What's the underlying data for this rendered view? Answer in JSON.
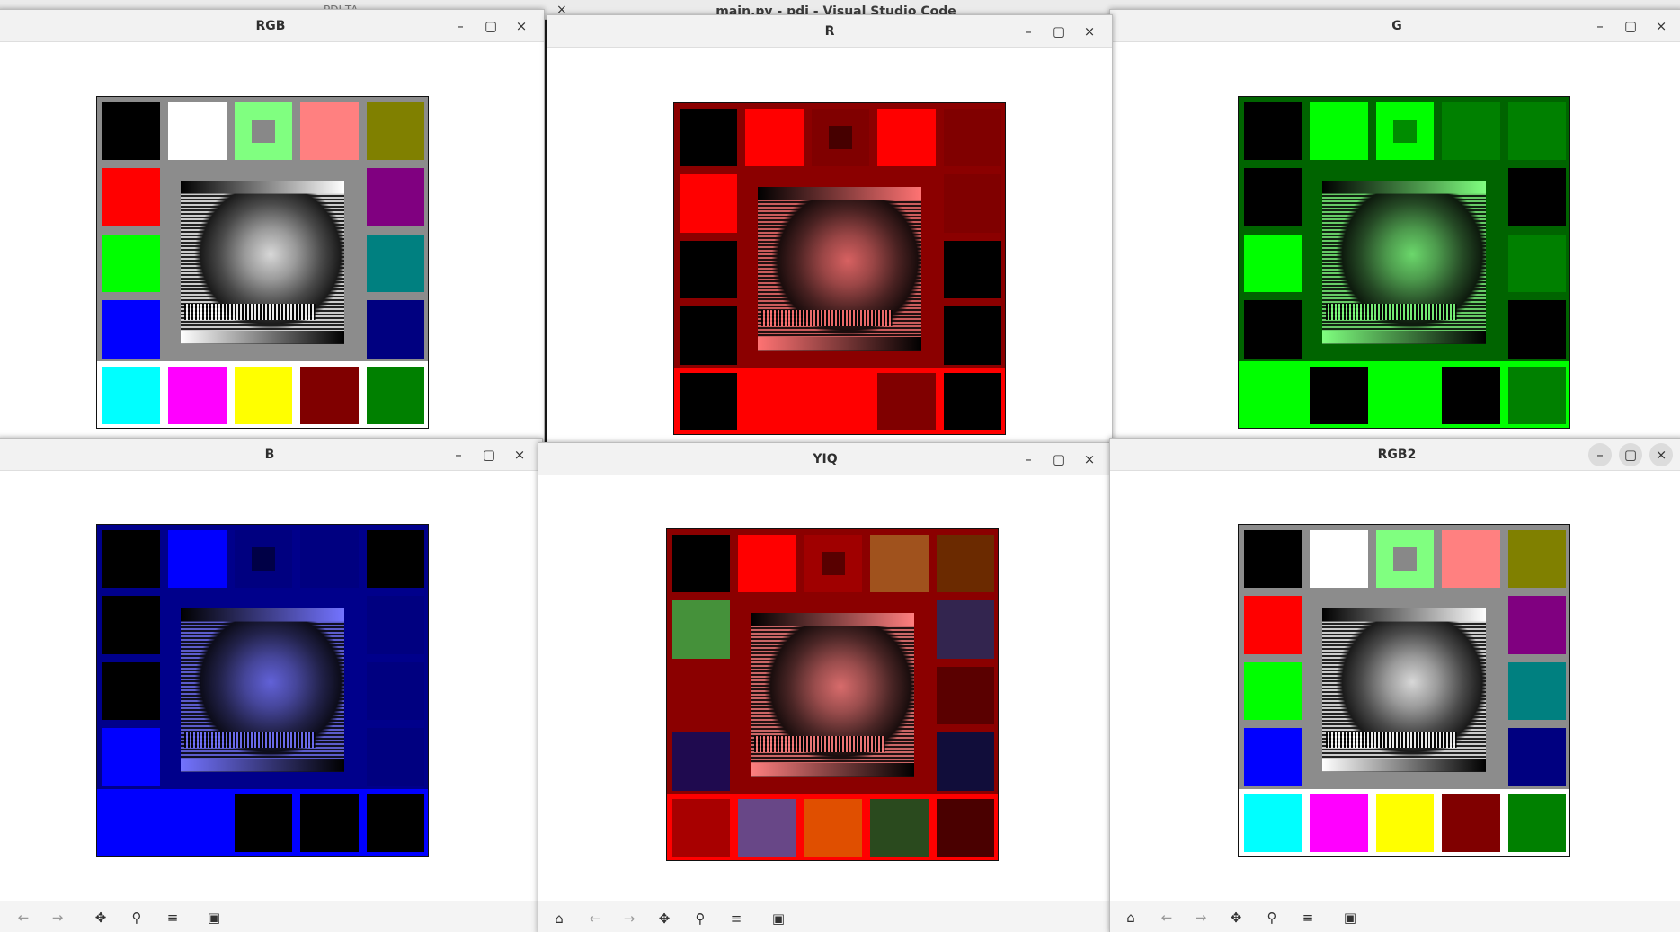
{
  "vscode": {
    "title": "main.py - pdi - Visual Studio Code",
    "partial_title": "PDI TA",
    "close": "×"
  },
  "controls": {
    "min": "–",
    "max": "▢",
    "close": "×"
  },
  "toolbar_icons": {
    "home": "⌂",
    "back": "←",
    "forward": "→",
    "pan": "✥",
    "zoom": "⚲",
    "configure": "≡",
    "save": "▣"
  },
  "windows": [
    {
      "id": "rgb",
      "title": "RGB",
      "cells": [
        "#000000",
        "#ffffff",
        "#80ff80",
        "#ff8080",
        "#808000",
        "#ff0000",
        "#800080",
        "#00ff00",
        "#008080",
        "#0000ff",
        "#000080",
        "#00ffff",
        "#ff00ff",
        "#ffff00",
        "#800000",
        "#008000"
      ],
      "frame": "#8c8c8c",
      "bottom": "#ffffff",
      "tint": ""
    },
    {
      "id": "r",
      "title": "R",
      "cells": [
        "#000000",
        "#ff0000",
        "#800000",
        "#ff0000",
        "#800000",
        "#ff0000",
        "#800000",
        "#000000",
        "#000000",
        "#000000",
        "#000000",
        "#000000",
        "#ff0000",
        "#ff0000",
        "#800000",
        "#000000"
      ],
      "frame": "#8b0000",
      "bottom": "#ff0000",
      "tint": "rgba(255,0,0,.55)"
    },
    {
      "id": "g",
      "title": "G",
      "cells": [
        "#000000",
        "#00ff00",
        "#00ff00",
        "#008000",
        "#008000",
        "#000000",
        "#000000",
        "#00ff00",
        "#008000",
        "#000000",
        "#000000",
        "#00ff00",
        "#000000",
        "#00ff00",
        "#000000",
        "#008000"
      ],
      "frame": "#006400",
      "bottom": "#00ff00",
      "tint": "rgba(0,255,0,.5)"
    },
    {
      "id": "b",
      "title": "B",
      "cells": [
        "#000000",
        "#0000ff",
        "#000080",
        "#000080",
        "#000000",
        "#000000",
        "#000080",
        "#000000",
        "#000080",
        "#0000ff",
        "#000080",
        "#0000ff",
        "#0000ff",
        "#000000",
        "#000000",
        "#000000"
      ],
      "frame": "#00008b",
      "bottom": "#0000ff",
      "tint": "rgba(0,0,255,.55)"
    },
    {
      "id": "yiq",
      "title": "YIQ",
      "cells": [
        "#000000",
        "#ff0000",
        "#a00000",
        "#a0521d",
        "#6b2a00",
        "#45913a",
        "#33254f",
        "#8b0000",
        "#5a0000",
        "#1f0a4f",
        "#110d3a",
        "#a80000",
        "#684787",
        "#e04f00",
        "#2a4a1e",
        "#4a0000"
      ],
      "frame": "#8b0000",
      "bottom": "#ff0000",
      "tint": "rgba(255,0,0,.5)"
    },
    {
      "id": "rgb2",
      "title": "RGB2",
      "cells": [
        "#000000",
        "#ffffff",
        "#80ff80",
        "#ff8080",
        "#808000",
        "#ff0000",
        "#800080",
        "#00ff00",
        "#008080",
        "#0000ff",
        "#000080",
        "#00ffff",
        "#ff00ff",
        "#ffff00",
        "#800000",
        "#008000"
      ],
      "frame": "#8c8c8c",
      "bottom": "#ffffff",
      "tint": ""
    }
  ]
}
